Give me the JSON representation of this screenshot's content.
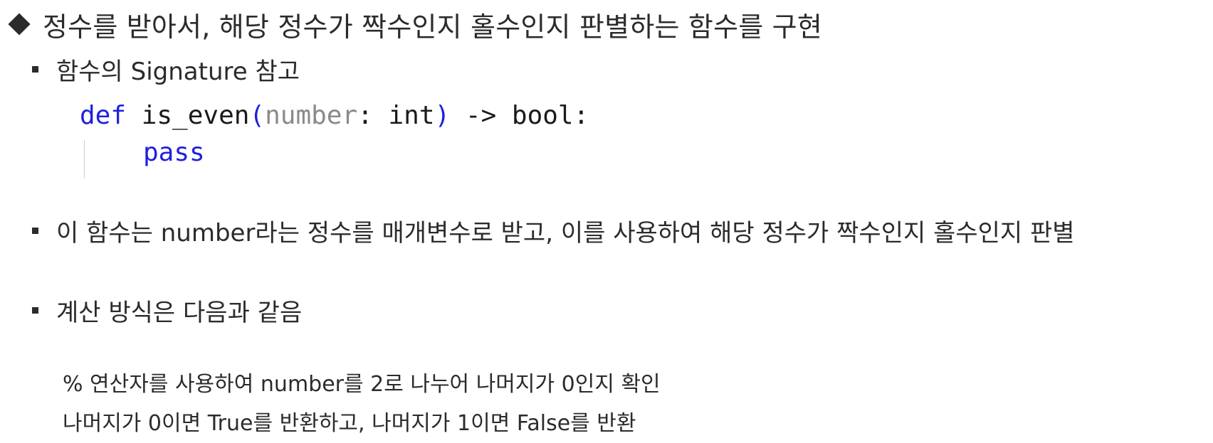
{
  "heading": {
    "icon": "diamond-icon",
    "text": "정수를 받아서, 해당 정수가 짝수인지 홀수인지 판별하는 함수를 구현"
  },
  "bullets": [
    {
      "text": "함수의 Signature 참고"
    },
    {
      "text": "이 함수는 number라는 정수를 매개변수로 받고, 이를 사용하여 해당 정수가 짝수인지 홀수인지 판별"
    },
    {
      "text": "계산 방식은 다음과 같음"
    }
  ],
  "code": {
    "def": "def",
    "name": " is_even",
    "lparen": "(",
    "param": "number",
    "colon_type": ": int",
    "rparen": ")",
    "ret": " -> bool:",
    "pass": "pass"
  },
  "details": [
    "% 연산자를 사용하여 number를 2로 나누어 나머지가 0인지 확인",
    "나머지가 0이면 True를 반환하고, 나머지가 1이면 False를 반환"
  ],
  "colors": {
    "keyword": "#1f1fe0",
    "param": "#8a8a8a",
    "text": "#2b2b2b"
  }
}
